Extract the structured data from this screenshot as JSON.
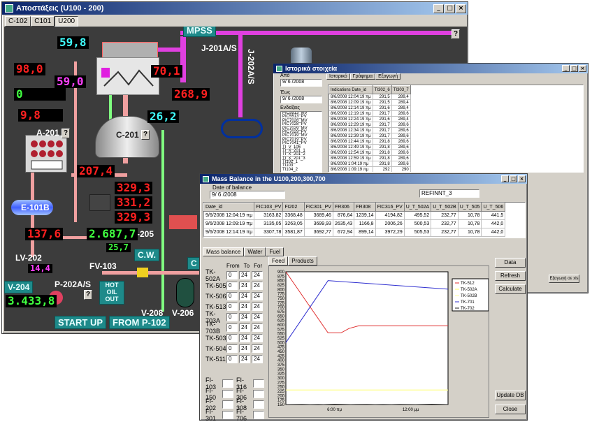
{
  "scada": {
    "title": "Αποστάξεις (U100 - 200)",
    "tabs": [
      "C-102",
      "C101",
      "U200"
    ],
    "labels": {
      "mpss": "MPSS",
      "j201": "J-201A/S",
      "j202": "J-202A/S",
      "a201": "A-201",
      "c201": "C-201",
      "e101b": "E-101B",
      "lv202": "LV-202",
      "v204": "V-204",
      "p202": "P-202A/S",
      "fv103": "FV-103",
      "e205": "E-205",
      "cw": "C.W.",
      "hot_oil_out": "HOT OIL OUT",
      "v208": "V-208",
      "v206": "V-206",
      "start_up": "START UP",
      "from_p102": "FROM P-102",
      "help": "?",
      "c_partial": "C"
    },
    "values": {
      "v1": "59,8",
      "v2": "98,0",
      "v3": "59,0",
      "v4": "70,1",
      "v5": "0",
      "v6": "268,9",
      "v7": "9,8",
      "v8": "26,2",
      "v9": "207,4",
      "v10": "329,3",
      "v11": "331,2",
      "v12": "329,3",
      "v13": "137,6",
      "v14": "2.687,7",
      "v15": "25,7",
      "v16": "14,4",
      "v17": "3.433,8"
    }
  },
  "history": {
    "title": "Ιστορικά στοιχεία",
    "from_label": "Από",
    "from_value": "9/ 6 /2008",
    "to_label": "Έως",
    "to_value": "9/ 6 /2008",
    "indicators_label": "Ενδείξεις",
    "indicators": [
      "PIC5513_MV",
      "PIC5513_PV",
      "PIC7028_MV",
      "PIC7028_PV",
      "PIC7029_MV",
      "PIC7029_PV",
      "PIC7019_MV",
      "PIC7019_PV",
      "PIC7041_PV",
      "TI_V_105",
      "TI_X_201_1",
      "TI_X_201_2",
      "TI_X_201_3",
      "TI102_1",
      "TI103",
      "TI104_2"
    ],
    "tabs": [
      "Ιστορικό",
      "Γράφημα",
      "Εξαγωγή"
    ],
    "columns": [
      "Indications Date_id",
      "TI302_6",
      "TI303_7"
    ],
    "rows": [
      [
        "8/6/2008 12:04:19 πμ",
        "291,5",
        "289,4"
      ],
      [
        "8/6/2008 12:09:19 πμ",
        "291,5",
        "289,4"
      ],
      [
        "8/6/2008 12:14:19 πμ",
        "291,6",
        "289,4"
      ],
      [
        "8/6/2008 12:19:19 πμ",
        "291,7",
        "289,6"
      ],
      [
        "8/6/2008 12:24:19 πμ",
        "291,6",
        "289,4"
      ],
      [
        "8/6/2008 12:29:19 πμ",
        "291,7",
        "289,6"
      ],
      [
        "8/6/2008 12:34:19 πμ",
        "291,7",
        "289,6"
      ],
      [
        "8/6/2008 12:39:19 πμ",
        "291,7",
        "289,6"
      ],
      [
        "8/6/2008 12:44:19 πμ",
        "291,8",
        "289,6"
      ],
      [
        "8/6/2008 12:49:19 πμ",
        "291,8",
        "289,6"
      ],
      [
        "8/6/2008 12:54:19 πμ",
        "291,8",
        "289,6"
      ],
      [
        "8/6/2008 12:59:19 πμ",
        "291,8",
        "289,6"
      ],
      [
        "8/6/2008 1:04:19 πμ",
        "291,8",
        "289,6"
      ],
      [
        "8/6/2008 1:09:19 πμ",
        "292",
        "290"
      ]
    ],
    "export_btn": "Εξαγωγή σε xls"
  },
  "mass": {
    "title": "Mass Balance in the U100,200,300,700",
    "date_label": "Date of balance",
    "date_value": "9/ 6 /2008",
    "refinery_value": "REFINNT_3",
    "columns": [
      "Date_id",
      "FIC103_PV",
      "FI202",
      "FIC301_PV",
      "FR306",
      "FR308",
      "FIC316_PV",
      "U_T_502A",
      "U_T_502B",
      "U_T_505",
      "U_T_506"
    ],
    "rows": [
      [
        "9/6/2008 12:04:19 πμ",
        "3163,82",
        "3368,48",
        "3689,46",
        "876,64",
        "1239,14",
        "4194,82",
        "495,52",
        "232,77",
        "10,78",
        "441,5"
      ],
      [
        "9/6/2008 12:09:19 πμ",
        "3135,05",
        "3263,05",
        "3699,93",
        "2635,43",
        "1166,8",
        "2006,26",
        "500,53",
        "232,77",
        "10,78",
        "442,0"
      ],
      [
        "9/6/2008 12:14:19 πμ",
        "3307,78",
        "3581,87",
        "3692,77",
        "672,94",
        "899,14",
        "3972,29",
        "505,53",
        "232,77",
        "10,78",
        "442,0"
      ]
    ],
    "tabs": [
      "Mass balance",
      "Water",
      "Fuel"
    ],
    "inner_tabs": [
      "Feed",
      "Products"
    ],
    "tank_headers": [
      "From",
      "To",
      "For"
    ],
    "tanks": [
      {
        "name": "TK-502A",
        "from": "0",
        "to": "24",
        "for": "24"
      },
      {
        "name": "TK-505",
        "from": "0",
        "to": "24",
        "for": "24"
      },
      {
        "name": "TK-506",
        "from": "0",
        "to": "24",
        "for": "24"
      },
      {
        "name": "TK-513",
        "from": "0",
        "to": "24",
        "for": "24"
      },
      {
        "name": "TK-703A",
        "from": "0",
        "to": "24",
        "for": "24"
      },
      {
        "name": "TK-703B",
        "from": "0",
        "to": "24",
        "for": "24"
      },
      {
        "name": "TK-503",
        "from": "0",
        "to": "24",
        "for": "24"
      },
      {
        "name": "TK-504",
        "from": "0",
        "to": "24",
        "for": "24"
      },
      {
        "name": "TK-511",
        "from": "0",
        "to": "24",
        "for": "24"
      }
    ],
    "fi_left": [
      "FI-103",
      "FI-150",
      "FI-202",
      "FI-301"
    ],
    "fi_right": [
      "FI-316",
      "FI-306",
      "FI-308",
      "FI-706"
    ],
    "buttons": {
      "data": "Data",
      "refresh": "Refresh",
      "calculate": "Calculate",
      "update": "Update DB",
      "close": "Close"
    }
  },
  "chart_data": {
    "type": "line",
    "x_ticks": [
      "6:00 πμ",
      "12:00 μμ"
    ],
    "ylim": [
      150,
      900
    ],
    "yticks": [
      150,
      175,
      200,
      225,
      250,
      275,
      300,
      325,
      350,
      375,
      400,
      425,
      450,
      475,
      500,
      525,
      550,
      575,
      600,
      625,
      650,
      675,
      700,
      725,
      750,
      775,
      800,
      825,
      850,
      875,
      900
    ],
    "y_tick_labels": [
      "900",
      "875",
      "850",
      "825",
      "800",
      "775",
      "750",
      "725",
      "700",
      "675",
      "650",
      "625",
      "600",
      "575",
      "550",
      "525",
      "500",
      "475",
      "450",
      "425",
      "400",
      "375",
      "350",
      "325",
      "300",
      "275",
      "250",
      "225",
      "200",
      "175",
      "150"
    ],
    "series": [
      {
        "name": "TK-512",
        "color": "#e03030",
        "x": [
          0,
          0.26,
          0.34,
          0.39,
          0.45,
          1
        ],
        "y": [
          900,
          555,
          555,
          580,
          595,
          595
        ]
      },
      {
        "name": "TK-502A",
        "color": "#ffff66",
        "x": [
          0,
          1
        ],
        "y": [
          232,
          232
        ]
      },
      {
        "name": "TK-502B",
        "color": "#ffff99",
        "x": [
          0,
          1
        ],
        "y": [
          232,
          232
        ]
      },
      {
        "name": "TK-701",
        "color": "#3030d0",
        "x": [
          0,
          0.26,
          1
        ],
        "y": [
          500,
          850,
          802
        ]
      },
      {
        "name": "TK-702",
        "color": "#202020",
        "x": [
          0,
          0.1,
          0.2,
          0.3,
          0.4,
          0.5,
          0.6,
          0.7,
          0.8,
          0.9,
          1
        ],
        "y": [
          150,
          151,
          149,
          152,
          150,
          151,
          149,
          151,
          150,
          152,
          150
        ]
      }
    ]
  }
}
